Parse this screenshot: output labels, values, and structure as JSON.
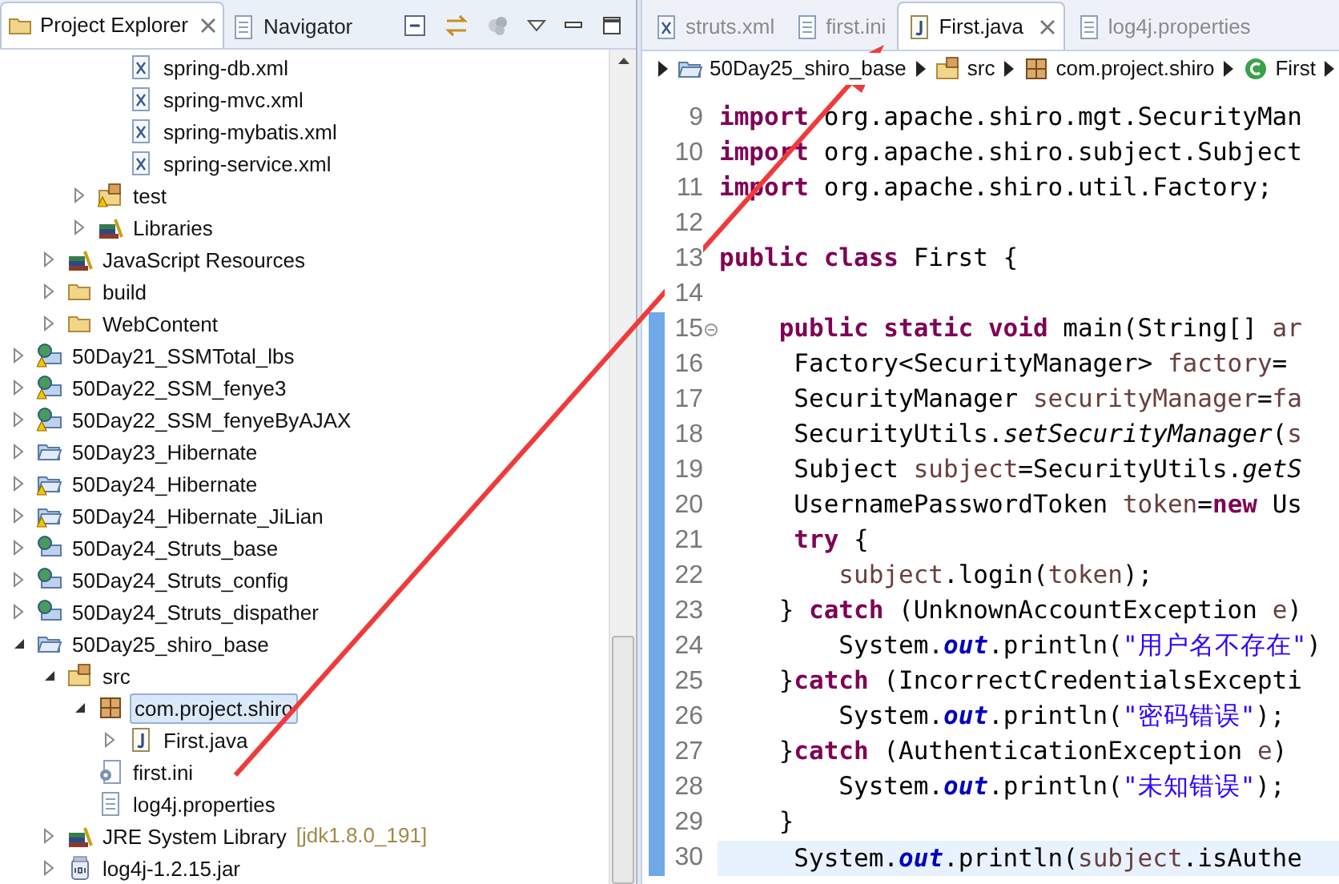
{
  "explorer": {
    "tabs": [
      {
        "label": "Project Explorer",
        "selected": true,
        "closable": true
      },
      {
        "label": "Navigator",
        "selected": false,
        "closable": false
      }
    ],
    "tree": [
      {
        "children": [
          {
            "children": [
              {
                "children": [
                  {
                    "label": "spring-db.xml",
                    "kind": "xml",
                    "selected": false
                  },
                  {
                    "label": "spring-mvc.xml",
                    "kind": "xml",
                    "selected": false
                  },
                  {
                    "label": "spring-mybatis.xml",
                    "kind": "xml",
                    "selected": false
                  },
                  {
                    "label": "spring-service.xml",
                    "kind": "xml",
                    "selected": false
                  }
                ]
              },
              {
                "label": "test",
                "kind": "source-folder",
                "expanded": false,
                "selected": false,
                "warning": true
              },
              {
                "label": "Libraries",
                "kind": "library",
                "expanded": false,
                "selected": false
              }
            ]
          },
          {
            "label": "JavaScript Resources",
            "kind": "library",
            "expanded": false,
            "selected": false
          },
          {
            "label": "build",
            "kind": "folder",
            "expanded": false,
            "selected": false
          },
          {
            "label": "WebContent",
            "kind": "folder",
            "expanded": false,
            "selected": false
          }
        ]
      },
      {
        "label": "50Day21_SSMTotal_lbs",
        "kind": "web-project",
        "expanded": false,
        "selected": false,
        "warning": true
      },
      {
        "label": "50Day22_SSM_fenye3",
        "kind": "web-project",
        "expanded": false,
        "selected": false,
        "warning": true
      },
      {
        "label": "50Day22_SSM_fenyeByAJAX",
        "kind": "web-project",
        "expanded": false,
        "selected": false,
        "warning": true
      },
      {
        "label": "50Day23_Hibernate",
        "kind": "project",
        "expanded": false,
        "selected": false,
        "warning": false
      },
      {
        "label": "50Day24_Hibernate",
        "kind": "project",
        "expanded": false,
        "selected": false,
        "warning": true
      },
      {
        "label": "50Day24_Hibernate_JiLian",
        "kind": "project",
        "expanded": false,
        "selected": false,
        "warning": true
      },
      {
        "label": "50Day24_Struts_base",
        "kind": "web-project",
        "expanded": false,
        "selected": false,
        "warning": false
      },
      {
        "label": "50Day24_Struts_config",
        "kind": "web-project",
        "expanded": false,
        "selected": false,
        "warning": false
      },
      {
        "label": "50Day24_Struts_dispather",
        "kind": "web-project",
        "expanded": false,
        "selected": false,
        "warning": false
      },
      {
        "label": "50Day25_shiro_base",
        "kind": "project",
        "expanded": true,
        "selected": false,
        "warning": false,
        "children": [
          {
            "label": "src",
            "kind": "source-folder",
            "expanded": true,
            "selected": false,
            "warning": false,
            "children": [
              {
                "label": "com.project.shiro",
                "kind": "package",
                "expanded": true,
                "selected": true,
                "children": [
                  {
                    "label": "First.java",
                    "kind": "java",
                    "expanded": false,
                    "selected": false
                  }
                ]
              },
              {
                "label": "first.ini",
                "kind": "ini",
                "selected": false
              },
              {
                "label": "log4j.properties",
                "kind": "text",
                "selected": false
              }
            ]
          },
          {
            "label": "JRE System Library",
            "decoration": "[jdk1.8.0_191]",
            "kind": "library",
            "expanded": false,
            "selected": false
          },
          {
            "label": "log4j-1.2.15.jar",
            "kind": "jar",
            "expanded": false,
            "selected": false
          }
        ]
      }
    ]
  },
  "editor": {
    "tabs": [
      {
        "label": "struts.xml",
        "kind": "xml",
        "selected": false,
        "closable": false
      },
      {
        "label": "first.ini",
        "kind": "text",
        "selected": false,
        "closable": false
      },
      {
        "label": "First.java",
        "kind": "java",
        "selected": true,
        "closable": true
      },
      {
        "label": "log4j.properties",
        "kind": "text",
        "selected": false,
        "closable": false
      }
    ],
    "breadcrumb": [
      {
        "label": "50Day25_shiro_base",
        "kind": "project"
      },
      {
        "label": "src",
        "kind": "source-folder"
      },
      {
        "label": "com.project.shiro",
        "kind": "package"
      },
      {
        "label": "First",
        "kind": "class"
      }
    ],
    "lines": [
      {
        "number": "9",
        "changed": false,
        "current": false,
        "tokens": [
          {
            "kind": "keyword",
            "text": "import"
          },
          {
            "kind": "plain",
            "text": " org.apache.shiro.mgt.SecurityMan"
          }
        ]
      },
      {
        "number": "10",
        "changed": false,
        "current": false,
        "tokens": [
          {
            "kind": "keyword",
            "text": "import"
          },
          {
            "kind": "plain",
            "text": " org.apache.shiro.subject.Subject"
          }
        ]
      },
      {
        "number": "11",
        "changed": false,
        "current": false,
        "tokens": [
          {
            "kind": "keyword",
            "text": "import"
          },
          {
            "kind": "plain",
            "text": " org.apache.shiro.util.Factory;"
          }
        ]
      },
      {
        "number": "12",
        "changed": false,
        "current": false
      },
      {
        "number": "13",
        "changed": false,
        "current": false,
        "tokens": [
          {
            "kind": "keyword",
            "text": "public class"
          },
          {
            "kind": "plain",
            "text": " First {"
          }
        ]
      },
      {
        "number": "14",
        "changed": false,
        "current": false
      },
      {
        "number": "15",
        "changed": true,
        "current": false,
        "foldable": true,
        "tokens": [
          {
            "kind": "keyword",
            "text": "    public static void"
          },
          {
            "kind": "plain",
            "text": " main(String[] "
          },
          {
            "kind": "variable",
            "text": "ar"
          }
        ]
      },
      {
        "number": "16",
        "changed": true,
        "current": false,
        "tokens": [
          {
            "kind": "plain",
            "text": "     Factory<SecurityManager> "
          },
          {
            "kind": "variable",
            "text": "factory"
          },
          {
            "kind": "plain",
            "text": "="
          }
        ]
      },
      {
        "number": "17",
        "changed": true,
        "current": false,
        "tokens": [
          {
            "kind": "plain",
            "text": "     SecurityManager "
          },
          {
            "kind": "variable",
            "text": "securityManager"
          },
          {
            "kind": "plain",
            "text": "="
          },
          {
            "kind": "variable",
            "text": "fa"
          }
        ]
      },
      {
        "number": "18",
        "changed": true,
        "current": false,
        "tokens": [
          {
            "kind": "plain",
            "text": "     SecurityUtils."
          },
          {
            "kind": "static-method",
            "text": "setSecurityManager"
          },
          {
            "kind": "plain",
            "text": "("
          },
          {
            "kind": "variable",
            "text": "s"
          }
        ]
      },
      {
        "number": "19",
        "changed": true,
        "current": false,
        "tokens": [
          {
            "kind": "plain",
            "text": "     Subject "
          },
          {
            "kind": "variable",
            "text": "subject"
          },
          {
            "kind": "plain",
            "text": "=SecurityUtils."
          },
          {
            "kind": "static-method",
            "text": "getS"
          }
        ]
      },
      {
        "number": "20",
        "changed": true,
        "current": false,
        "tokens": [
          {
            "kind": "plain",
            "text": "     UsernamePasswordToken "
          },
          {
            "kind": "variable",
            "text": "token"
          },
          {
            "kind": "plain",
            "text": "="
          },
          {
            "kind": "keyword",
            "text": "new"
          },
          {
            "kind": "plain",
            "text": " Us"
          }
        ]
      },
      {
        "number": "21",
        "changed": true,
        "current": false,
        "tokens": [
          {
            "kind": "keyword",
            "text": "     try"
          },
          {
            "kind": "plain",
            "text": " {"
          }
        ]
      },
      {
        "number": "22",
        "changed": true,
        "current": false,
        "tokens": [
          {
            "kind": "variable",
            "text": "        subject"
          },
          {
            "kind": "plain",
            "text": ".login("
          },
          {
            "kind": "variable",
            "text": "token"
          },
          {
            "kind": "plain",
            "text": ");"
          }
        ]
      },
      {
        "number": "23",
        "changed": true,
        "current": false,
        "tokens": [
          {
            "kind": "plain",
            "text": "    } "
          },
          {
            "kind": "keyword",
            "text": "catch"
          },
          {
            "kind": "plain",
            "text": " (UnknownAccountException "
          },
          {
            "kind": "variable",
            "text": "e"
          },
          {
            "kind": "plain",
            "text": ")"
          }
        ]
      },
      {
        "number": "24",
        "changed": true,
        "current": false,
        "tokens": [
          {
            "kind": "plain",
            "text": "        System."
          },
          {
            "kind": "static-field",
            "text": "out"
          },
          {
            "kind": "plain",
            "text": ".println("
          },
          {
            "kind": "string",
            "text": "\"用户名不存在\""
          },
          {
            "kind": "plain",
            "text": ")"
          }
        ]
      },
      {
        "number": "25",
        "changed": true,
        "current": false,
        "tokens": [
          {
            "kind": "plain",
            "text": "    }"
          },
          {
            "kind": "keyword",
            "text": "catch"
          },
          {
            "kind": "plain",
            "text": " (IncorrectCredentialsExcepti"
          }
        ]
      },
      {
        "number": "26",
        "changed": true,
        "current": false,
        "tokens": [
          {
            "kind": "plain",
            "text": "        System."
          },
          {
            "kind": "static-field",
            "text": "out"
          },
          {
            "kind": "plain",
            "text": ".println("
          },
          {
            "kind": "string",
            "text": "\"密码错误\""
          },
          {
            "kind": "plain",
            "text": ");"
          }
        ]
      },
      {
        "number": "27",
        "changed": true,
        "current": false,
        "tokens": [
          {
            "kind": "plain",
            "text": "    }"
          },
          {
            "kind": "keyword",
            "text": "catch"
          },
          {
            "kind": "plain",
            "text": " (AuthenticationException "
          },
          {
            "kind": "variable",
            "text": "e"
          },
          {
            "kind": "plain",
            "text": ")"
          }
        ]
      },
      {
        "number": "28",
        "changed": true,
        "current": false,
        "tokens": [
          {
            "kind": "plain",
            "text": "        System."
          },
          {
            "kind": "static-field",
            "text": "out"
          },
          {
            "kind": "plain",
            "text": ".println("
          },
          {
            "kind": "string",
            "text": "\"未知错误\""
          },
          {
            "kind": "plain",
            "text": ");"
          }
        ]
      },
      {
        "number": "29",
        "changed": true,
        "current": false,
        "tokens": [
          {
            "kind": "plain",
            "text": "    }"
          }
        ]
      },
      {
        "number": "30",
        "changed": true,
        "current": true,
        "tokens": [
          {
            "kind": "plain",
            "text": "     System."
          },
          {
            "kind": "static-field",
            "text": "out"
          },
          {
            "kind": "plain",
            "text": ".println("
          },
          {
            "kind": "variable",
            "text": "subject"
          },
          {
            "kind": "plain",
            "text": ".isAuthe"
          }
        ]
      }
    ]
  }
}
